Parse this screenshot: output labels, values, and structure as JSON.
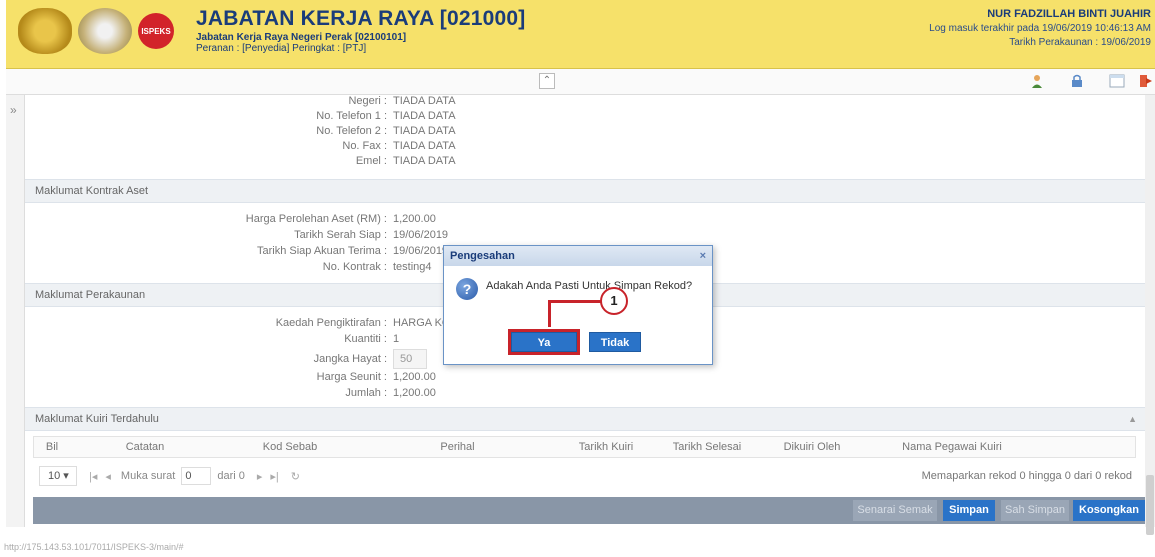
{
  "header": {
    "title": "JABATAN KERJA RAYA [021000]",
    "subtitle": "Jabatan Kerja Raya Negeri Perak [02100101]",
    "role": "Peranan : [Penyedia] Peringkat : [PTJ]",
    "user_name": "NUR FADZILLAH BINTI JUAHIR",
    "last_login": "Log masuk terakhir pada 19/06/2019 10:46:13 AM",
    "account_date": "Tarikh Perakaunan : 19/06/2019",
    "logo3_text": "ISPEKS"
  },
  "toolbar": {
    "collapse_icon": "⌃",
    "icons": [
      "user-icon",
      "lock-icon",
      "window-icon",
      "logout-icon"
    ]
  },
  "contact": {
    "rows": [
      {
        "label": "Negeri :",
        "value": "TIADA DATA"
      },
      {
        "label": "No. Telefon 1 :",
        "value": "TIADA DATA"
      },
      {
        "label": "No. Telefon 2 :",
        "value": "TIADA DATA"
      },
      {
        "label": "No. Fax :",
        "value": "TIADA DATA"
      },
      {
        "label": "Emel :",
        "value": "TIADA DATA"
      }
    ]
  },
  "kontrak": {
    "title": "Maklumat Kontrak Aset",
    "rows": [
      {
        "label": "Harga Perolehan Aset (RM) :",
        "value": "1,200.00"
      },
      {
        "label": "Tarikh Serah Siap :",
        "value": "19/06/2019"
      },
      {
        "label": "Tarikh Siap Akuan Terima :",
        "value": "19/06/2019"
      },
      {
        "label": "No. Kontrak :",
        "value": "testing4"
      }
    ]
  },
  "perakaunan": {
    "title": "Maklumat Perakaunan",
    "kaedah_label": "Kaedah Pengiktirafan :",
    "kaedah_value": "HARGA KOS",
    "kuantiti_label": "Kuantiti :",
    "kuantiti_value": "1",
    "jangka_label": "Jangka Hayat :",
    "jangka_value": "50",
    "seunit_label": "Harga Seunit :",
    "seunit_value": "1,200.00",
    "jumlah_label": "Jumlah :",
    "jumlah_value": "1,200.00"
  },
  "kuiri": {
    "title": "Maklumat Kuiri Terdahulu",
    "columns": [
      "Bil",
      "Catatan",
      "Kod Sebab",
      "Perihal",
      "Tarikh Kuiri",
      "Tarikh Selesai",
      "Dikuiri Oleh",
      "Nama Pegawai Kuiri"
    ],
    "page_size": "10",
    "page_label": "Muka surat",
    "page_value": "0",
    "of_label": "dari 0",
    "info": "Memaparkan rekod 0 hingga 0 dari 0 rekod"
  },
  "actions": {
    "senarai_semak": "Senarai Semak",
    "simpan": "Simpan",
    "sah_simpan": "Sah Simpan",
    "kosongkan": "Kosongkan"
  },
  "dialog": {
    "title": "Pengesahan",
    "close": "×",
    "message": "Adakah Anda Pasti Untuk Simpan Rekod?",
    "yes": "Ya",
    "no": "Tidak",
    "marker": "1"
  },
  "status_bar": "http://175.143.53.101/7011/ISPEKS-3/main/#",
  "colors": {
    "header_bg": "#f6e16a",
    "primary_button": "#2a73c8",
    "highlight": "#c8232a",
    "action_bar": "#8996a7"
  }
}
